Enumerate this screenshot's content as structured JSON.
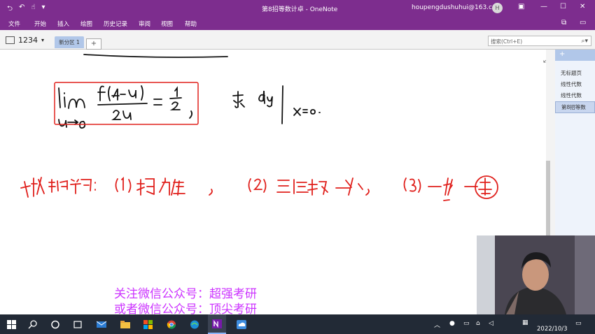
{
  "window": {
    "doc_title": "第8招等数计卓 - OneNote",
    "user_email": "houpengdushuhui@163.com",
    "avatar_initial": "H"
  },
  "menu": [
    "文件",
    "开始",
    "插入",
    "绘图",
    "历史记录",
    "审阅",
    "视图",
    "帮助"
  ],
  "notebook": {
    "name": "1234",
    "section_tab": "新分区 1",
    "add_tab": "+"
  },
  "search": {
    "placeholder": "搜索(Ctrl+E)"
  },
  "pages": {
    "add": "+",
    "items": [
      "无标题页",
      "线性代数",
      "线性代数",
      "第8招等数"
    ],
    "active_index": 3
  },
  "watermark": {
    "line1": "关注微信公众号：超强考研",
    "line2": "或者微信公众号：顶尖考研"
  },
  "taskbar": {
    "date": "2022/10/3"
  },
  "colors": {
    "title_bar": "#7d2d8e",
    "section_tab": "#b1c7e9",
    "ink_black": "#111111",
    "ink_red": "#e0201c",
    "watermark": "#cc33ff",
    "taskbar": "#222a36"
  }
}
